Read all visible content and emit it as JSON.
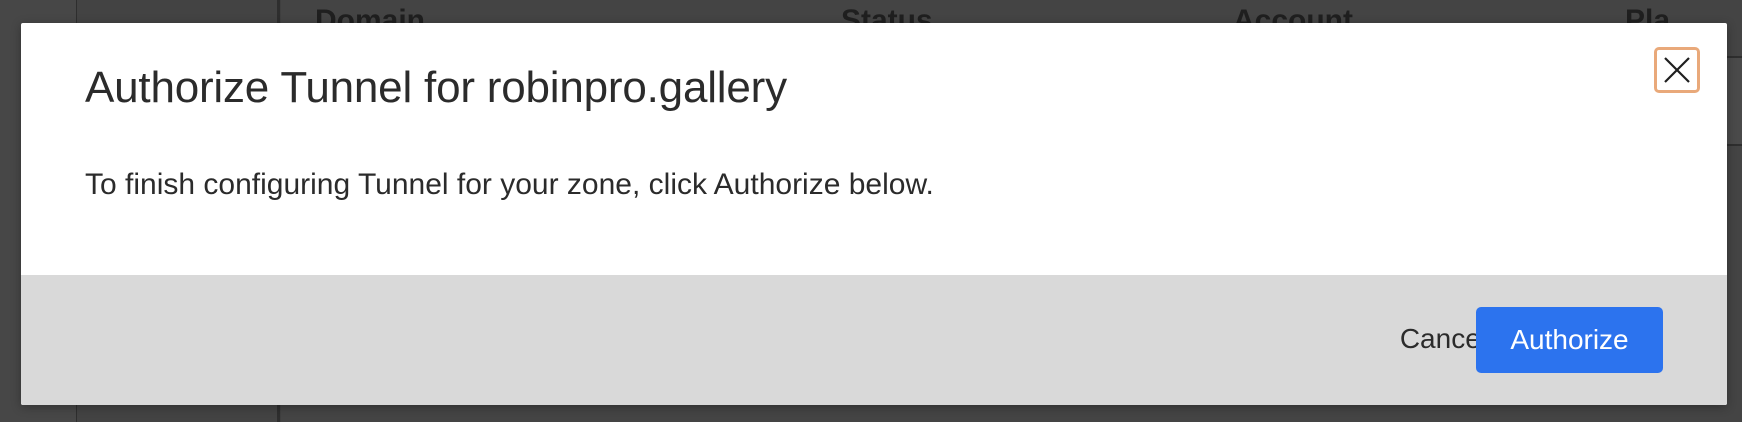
{
  "background": {
    "table_headers": [
      "Domain",
      "Status",
      "Account",
      "Pla"
    ]
  },
  "modal": {
    "title": "Authorize Tunnel for robinpro.gallery",
    "body": "To finish configuring Tunnel for your zone, click Authorize below.",
    "close_icon": "close-icon",
    "cancel_label": "Cancel",
    "authorize_label": "Authorize",
    "accent_color": "#2c73ee",
    "focus_ring_color": "#e9a97a"
  }
}
